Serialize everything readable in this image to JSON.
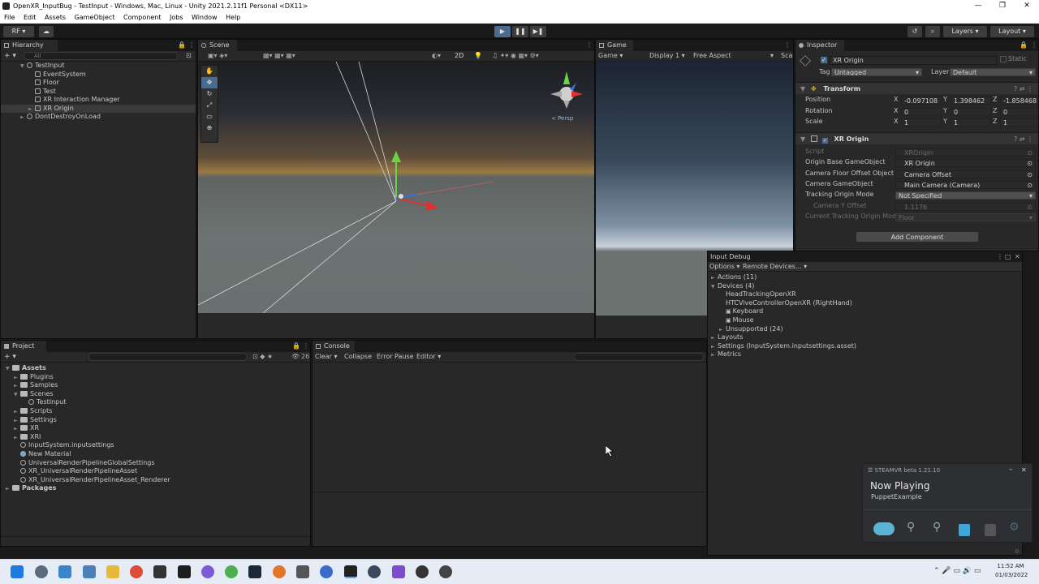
{
  "window": {
    "title": "OpenXR_InputBug - TestInput - Windows, Mac, Linux - Unity 2021.2.11f1 Personal <DX11>",
    "controls": [
      "—",
      "❐",
      "✕"
    ]
  },
  "menu": [
    "File",
    "Edit",
    "Assets",
    "GameObject",
    "Component",
    "Jobs",
    "Window",
    "Help"
  ],
  "toolbar": {
    "account": "RF",
    "layers": "Layers",
    "layout": "Layout"
  },
  "hierarchy": {
    "tab": "Hierarchy",
    "search_placeholder": "All",
    "items": [
      {
        "label": "TestInput",
        "indent": 0,
        "arrow": "▼",
        "type": "scene"
      },
      {
        "label": "EventSystem",
        "indent": 1,
        "arrow": "",
        "type": "object"
      },
      {
        "label": "Floor",
        "indent": 1,
        "arrow": "",
        "type": "object"
      },
      {
        "label": "Test",
        "indent": 1,
        "arrow": "",
        "type": "object"
      },
      {
        "label": "XR Interaction Manager",
        "indent": 1,
        "arrow": "",
        "type": "object"
      },
      {
        "label": "XR Origin",
        "indent": 1,
        "arrow": "►",
        "type": "object",
        "selected": true
      },
      {
        "label": "DontDestroyOnLoad",
        "indent": 0,
        "arrow": "►",
        "type": "scene"
      }
    ]
  },
  "scene": {
    "tab": "Scene",
    "mode_2d": "2D",
    "persp": "< Persp"
  },
  "game": {
    "tab": "Game",
    "view": "Game",
    "display": "Display 1",
    "aspect": "Free Aspect",
    "scale": "Sca"
  },
  "inspector": {
    "tab": "Inspector",
    "object_name": "XR Origin",
    "static_label": "Static",
    "tag_label": "Tag",
    "tag_value": "Untagged",
    "layer_label": "Layer",
    "layer_value": "Default",
    "transform": {
      "title": "Transform",
      "rows": [
        {
          "label": "Position",
          "x": "-0.097108",
          "y": "1.398462",
          "z": "-1.858468"
        },
        {
          "label": "Rotation",
          "x": "0",
          "y": "0",
          "z": "0"
        },
        {
          "label": "Scale",
          "x": "1",
          "y": "1",
          "z": "1"
        }
      ]
    },
    "xr_origin": {
      "title": "XR Origin",
      "fields": [
        {
          "label": "Script",
          "value": "XROrigin",
          "dim": true
        },
        {
          "label": "Origin Base GameObject",
          "value": "XR Origin",
          "dim": false
        },
        {
          "label": "Camera Floor Offset Object",
          "value": "Camera Offset",
          "dim": false
        },
        {
          "label": "Camera GameObject",
          "value": "Main Camera (Camera)",
          "dim": false
        },
        {
          "label": "Tracking Origin Mode",
          "value": "Not Specified",
          "dim": false,
          "dropdown": true
        },
        {
          "label": "Camera Y Offset",
          "value": "1.1176",
          "dim": true,
          "indent": true
        },
        {
          "label": "Current Tracking Origin Mode",
          "value": "Floor",
          "dim": true,
          "dropdown": true
        }
      ]
    },
    "add_component": "Add Component"
  },
  "project": {
    "tab": "Project",
    "badge": "26",
    "items": [
      {
        "label": "Assets",
        "indent": 0,
        "arrow": "▼",
        "type": "folder",
        "bold": true
      },
      {
        "label": "Plugins",
        "indent": 1,
        "arrow": "►",
        "type": "folder"
      },
      {
        "label": "Samples",
        "indent": 1,
        "arrow": "►",
        "type": "folder"
      },
      {
        "label": "Scenes",
        "indent": 1,
        "arrow": "▼",
        "type": "folder"
      },
      {
        "label": "TestInput",
        "indent": 2,
        "arrow": "",
        "type": "scene"
      },
      {
        "label": "Scripts",
        "indent": 1,
        "arrow": "►",
        "type": "folder"
      },
      {
        "label": "Settings",
        "indent": 1,
        "arrow": "►",
        "type": "folder"
      },
      {
        "label": "XR",
        "indent": 1,
        "arrow": "►",
        "type": "folder"
      },
      {
        "label": "XRI",
        "indent": 1,
        "arrow": "►",
        "type": "folder"
      },
      {
        "label": "InputSystem.inputsettings",
        "indent": 1,
        "arrow": "",
        "type": "asset"
      },
      {
        "label": "New Material",
        "indent": 1,
        "arrow": "",
        "type": "material"
      },
      {
        "label": "UniversalRenderPipelineGlobalSettings",
        "indent": 1,
        "arrow": "",
        "type": "asset"
      },
      {
        "label": "XR_UniversalRenderPipelineAsset",
        "indent": 1,
        "arrow": "",
        "type": "asset"
      },
      {
        "label": "XR_UniversalRenderPipelineAsset_Renderer",
        "indent": 1,
        "arrow": "",
        "type": "asset"
      },
      {
        "label": "Packages",
        "indent": 0,
        "arrow": "►",
        "type": "folder",
        "bold": true
      }
    ]
  },
  "console": {
    "tab": "Console",
    "clear": "Clear",
    "collapse": "Collapse",
    "error_pause": "Error Pause",
    "editor": "Editor"
  },
  "input_debug": {
    "title": "Input Debug",
    "options": "Options",
    "remote": "Remote Devices...",
    "items": [
      {
        "label": "Actions (11)",
        "indent": 0,
        "arrow": "►"
      },
      {
        "label": "Devices (4)",
        "indent": 0,
        "arrow": "▼"
      },
      {
        "label": "HeadTrackingOpenXR",
        "indent": 1,
        "arrow": ""
      },
      {
        "label": "HTCViveControllerOpenXR (RightHand)",
        "indent": 1,
        "arrow": ""
      },
      {
        "label": "Keyboard",
        "indent": 1,
        "arrow": "",
        "icon": "⌨"
      },
      {
        "label": "Mouse",
        "indent": 1,
        "arrow": "",
        "icon": "🖱"
      },
      {
        "label": "Unsupported (24)",
        "indent": 1,
        "arrow": "►"
      },
      {
        "label": "Layouts",
        "indent": 0,
        "arrow": "►"
      },
      {
        "label": "Settings (InputSystem.inputsettings.asset)",
        "indent": 0,
        "arrow": "►"
      },
      {
        "label": "Metrics",
        "indent": 0,
        "arrow": "►"
      }
    ]
  },
  "steamvr": {
    "title": "STEAMVR beta 1.21.10",
    "now_playing": "Now Playing",
    "app": "PuppetExample"
  },
  "taskbar": {
    "time": "11:52 AM",
    "date": "01/03/2022"
  },
  "colors": {
    "panel": "#282828",
    "accent": "#4a6b8f",
    "selected_row": "#2c5d87"
  }
}
